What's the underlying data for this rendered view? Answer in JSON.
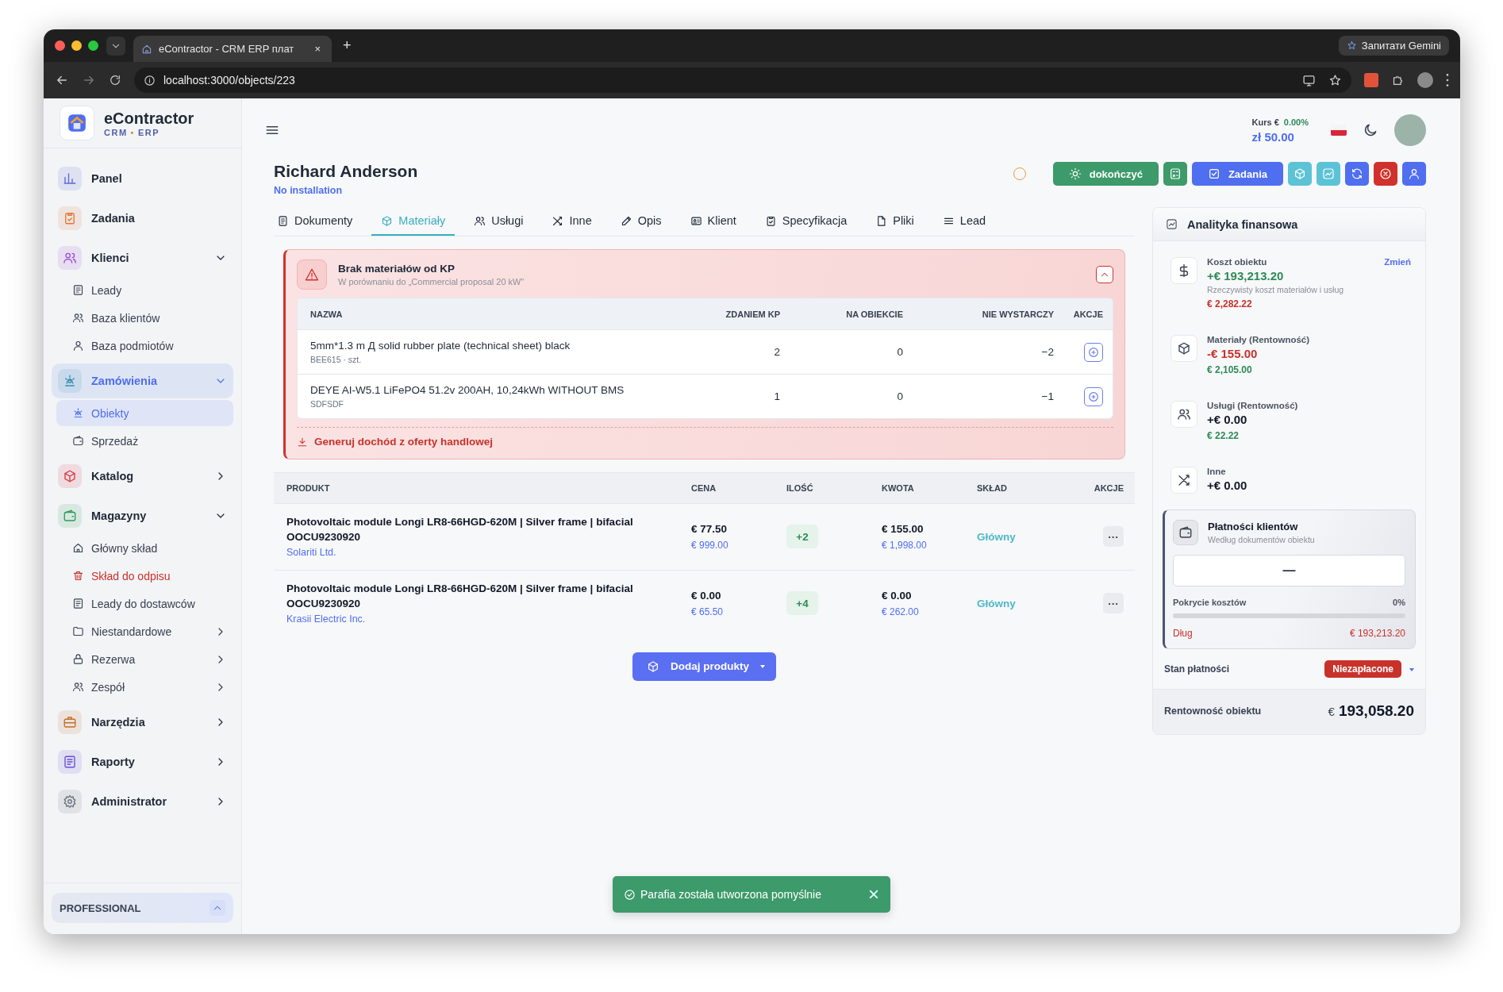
{
  "browser": {
    "tab_title": "eContractor - CRM ERP плат",
    "tab_close": "×",
    "new_tab": "+",
    "gemini": "Запитати Gemini",
    "url": "localhost:3000/objects/223"
  },
  "sidebar": {
    "logo_title": "eContractor",
    "logo_sub_1": "CRM",
    "logo_dot": "•",
    "logo_sub_2": "ERP",
    "items": [
      {
        "label": "Panel",
        "selected": false
      },
      {
        "label": "Zadania",
        "selected": false
      },
      {
        "label": "Klienci",
        "selected": false,
        "expanded": true,
        "children": [
          {
            "label": "Leady",
            "kind": "normal",
            "selected": false
          },
          {
            "label": "Baza klientów",
            "kind": "normal",
            "selected": false
          },
          {
            "label": "Baza podmiotów",
            "kind": "normal",
            "selected": false
          }
        ]
      },
      {
        "label": "Zamówienia",
        "selected": true,
        "expanded": true,
        "children": [
          {
            "label": "Obiekty",
            "kind": "normal",
            "selected": true
          },
          {
            "label": "Sprzedaż",
            "kind": "normal",
            "selected": false
          }
        ]
      },
      {
        "label": "Katalog",
        "selected": false,
        "expanded": false
      },
      {
        "label": "Magazyny",
        "selected": false,
        "expanded": true,
        "children": [
          {
            "label": "Główny skład",
            "kind": "normal",
            "selected": false
          },
          {
            "label": "Skład do odpisu",
            "kind": "danger",
            "selected": false
          },
          {
            "label": "Leady do dostawców",
            "kind": "normal",
            "selected": false
          },
          {
            "label": "Niestandardowe",
            "kind": "normal",
            "selected": false,
            "expanded": false
          },
          {
            "label": "Rezerwa",
            "kind": "normal",
            "selected": false,
            "expanded": false
          },
          {
            "label": "Zespół",
            "kind": "normal",
            "selected": false,
            "expanded": false
          }
        ]
      },
      {
        "label": "Narzędzia",
        "selected": false,
        "expanded": false
      },
      {
        "label": "Raporty",
        "selected": false,
        "expanded": false
      },
      {
        "label": "Administrator",
        "selected": false,
        "expanded": false
      }
    ],
    "plan": {
      "label": "PROFESSIONAL",
      "expanded": true
    }
  },
  "header": {
    "rate_label": "Kurs €",
    "rate_change": "0.00%",
    "rate_value": "zł 50.00"
  },
  "object": {
    "title": "Richard Anderson",
    "subtitle": "No installation"
  },
  "actions": [
    {
      "kind": "text",
      "label": "dokończyć",
      "color": "#3d9a6a"
    },
    {
      "kind": "icon",
      "color": "#3d9a6a"
    },
    {
      "kind": "text",
      "label": "Zadania",
      "color": "#4f6ef0"
    },
    {
      "kind": "icon",
      "color": "#5cc3d6"
    },
    {
      "kind": "icon",
      "color": "#5cc3d6"
    },
    {
      "kind": "icon",
      "color": "#4f6ef0"
    },
    {
      "kind": "icon",
      "color": "#d0312d"
    },
    {
      "kind": "icon",
      "color": "#4f6ef0"
    }
  ],
  "tabs": [
    {
      "label": "Dokumenty",
      "selected": false
    },
    {
      "label": "Materiały",
      "selected": true
    },
    {
      "label": "Usługi",
      "selected": false
    },
    {
      "label": "Inne",
      "selected": false
    },
    {
      "label": "Opis",
      "selected": false
    },
    {
      "label": "Klient",
      "selected": false
    },
    {
      "label": "Specyfikacja",
      "selected": false
    },
    {
      "label": "Pliki",
      "selected": false
    },
    {
      "label": "Lead",
      "selected": false
    }
  ],
  "alert": {
    "title": "Brak materiałów od KP",
    "subtitle": "W porównaniu do „Commercial proposal 20 kW”",
    "expanded": true,
    "columns": [
      "NAZWA",
      "ZDANIEM KP",
      "NA OBIEKCIE",
      "NIE WYSTARCZY",
      "AKCJE"
    ],
    "rows": [
      {
        "name": "5mm*1.3 m Д solid rubber plate (technical sheet) black",
        "code": "BEE615 · szt.",
        "per_kp": "2",
        "on_site": "0",
        "missing": "−2"
      },
      {
        "name": "DEYE AI-W5.1 LiFePO4 51.2v 200AH, 10,24kWh WITHOUT BMS",
        "code": "SDFSDF",
        "per_kp": "1",
        "on_site": "0",
        "missing": "−1"
      }
    ],
    "link": "Generuj dochód z oferty handlowej"
  },
  "products": {
    "columns": [
      "PRODUKT",
      "CENA",
      "ILOŚĆ",
      "KWOTA",
      "SKŁAD",
      "AKCJE"
    ],
    "rows": [
      {
        "name": "Photovoltaic module Longi LR8-66HGD-620M | Silver frame | bifacial OOCU9230920",
        "supplier": "Solariti Ltd.",
        "price": "€ 77.50",
        "price_sub": "€ 999.00",
        "qty": "+2",
        "amount": "€ 155.00",
        "amount_sub": "€ 1,998.00",
        "warehouse": "Główny",
        "menu": "···"
      },
      {
        "name": "Photovoltaic module Longi LR8-66HGD-620M | Silver frame | bifacial OOCU9230920",
        "supplier": "Krasii Electric Inc.",
        "price": "€ 0.00",
        "price_sub": "€ 65.50",
        "qty": "+4",
        "amount": "€ 0.00",
        "amount_sub": "€ 262.00",
        "warehouse": "Główny",
        "menu": "···"
      }
    ],
    "add_button": "Dodaj produkty"
  },
  "analytics": {
    "title": "Analityka finansowa",
    "items": [
      {
        "label": "Koszt obiektu",
        "value": "+€ 193,213.20",
        "color": "#2e8a57",
        "note": "Rzeczywisty koszt materiałów i usług",
        "sub": {
          "text": "€ 2,282.22",
          "color": "#c8322b"
        },
        "link": "Zmień"
      },
      {
        "label": "Materiały (Rentowność)",
        "value": "-€ 155.00",
        "color": "#c8322b",
        "sub": {
          "text": "€ 2,105.00",
          "color": "#2e8a57"
        }
      },
      {
        "label": "Usługi (Rentowność)",
        "value": "+€ 0.00",
        "color": "#111827",
        "sub": {
          "text": "€ 22.22",
          "color": "#2e8a57"
        }
      },
      {
        "label": "Inne",
        "value": "+€ 0.00",
        "color": "#111827"
      }
    ],
    "payments": {
      "title": "Płatności klientów",
      "subtitle": "Według dokumentów obiektu",
      "value": "—",
      "coverage_label": "Pokrycie kosztów",
      "coverage_value": "0%",
      "level": 0,
      "debt_label": "Dług",
      "debt_value": "€ 193,213.20"
    },
    "status_label": "Stan płatności",
    "status": "Niezapłacone",
    "profit_label": "Rentowność obiektu",
    "profit_currency": "€",
    "profit_value": "193,058.20"
  },
  "toast": {
    "message": "Parafia została utworzona pomyślnie",
    "close": "×"
  }
}
